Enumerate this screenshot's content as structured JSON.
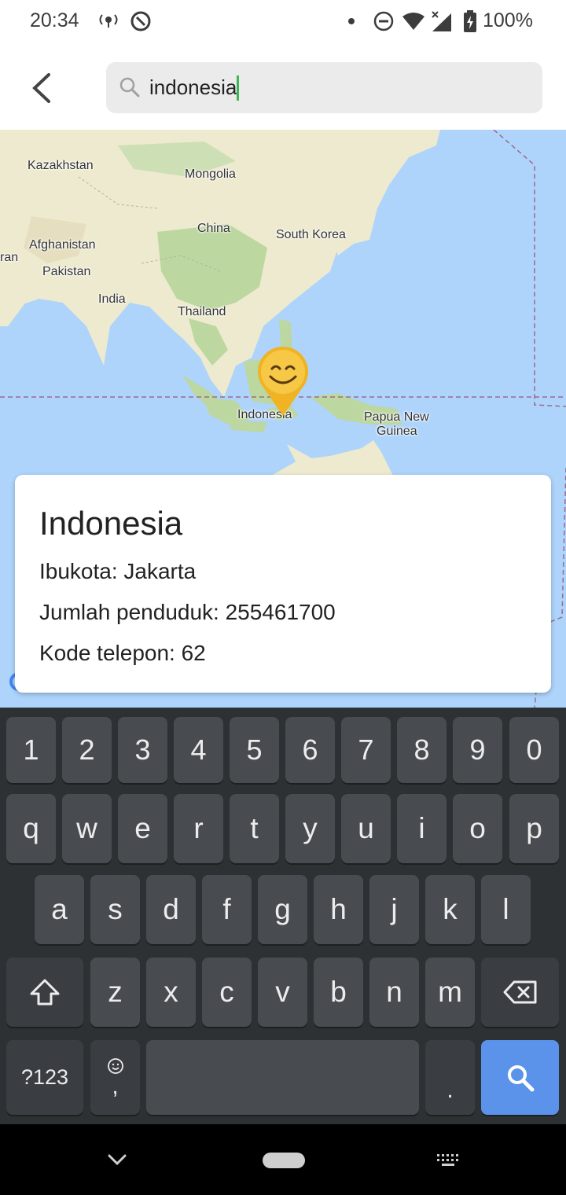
{
  "status_bar": {
    "time": "20:34",
    "battery": "100%",
    "icons": [
      "location-broadcast-icon",
      "at-sign-icon",
      "notification-dot-icon",
      "do-not-disturb-icon",
      "wifi-icon",
      "cellular-no-data-icon",
      "battery-charging-icon"
    ]
  },
  "search": {
    "query": "indonesia",
    "back_icon": "back-arrow-icon",
    "search_icon": "magnifier-icon"
  },
  "map": {
    "labels": [
      "Kazakhstan",
      "Mongolia",
      "China",
      "South Korea",
      "Afghanistan",
      "Pakistan",
      "India",
      "Thailand",
      "Indonesia",
      "Papua New",
      "Guinea",
      "ran"
    ],
    "marker_icon": "smiley-pin-icon",
    "colors": {
      "water": "#aed4fb",
      "land": "#eeeacf",
      "forest": "#bcd7a0",
      "marker": "#f0b323"
    }
  },
  "card": {
    "title": "Indonesia",
    "capital": "Ibukota: Jakarta",
    "population": "Jumlah penduduk: 255461700",
    "phone_code": "Kode telepon: 62"
  },
  "keyboard": {
    "numbers": [
      "1",
      "2",
      "3",
      "4",
      "5",
      "6",
      "7",
      "8",
      "9",
      "0"
    ],
    "row1": [
      "q",
      "w",
      "e",
      "r",
      "t",
      "y",
      "u",
      "i",
      "o",
      "p"
    ],
    "row2": [
      "a",
      "s",
      "d",
      "f",
      "g",
      "h",
      "j",
      "k",
      "l"
    ],
    "row3": [
      "z",
      "x",
      "c",
      "v",
      "b",
      "n",
      "m"
    ],
    "symbols_label": "?123",
    "comma": ",",
    "period": ".",
    "colors": {
      "background": "#2d3134",
      "key": "#484c50",
      "action": "#5b93ea"
    }
  },
  "nav_bar": {
    "icons": [
      "collapse-chevron-icon",
      "home-pill-icon",
      "keyboard-switch-icon"
    ]
  }
}
